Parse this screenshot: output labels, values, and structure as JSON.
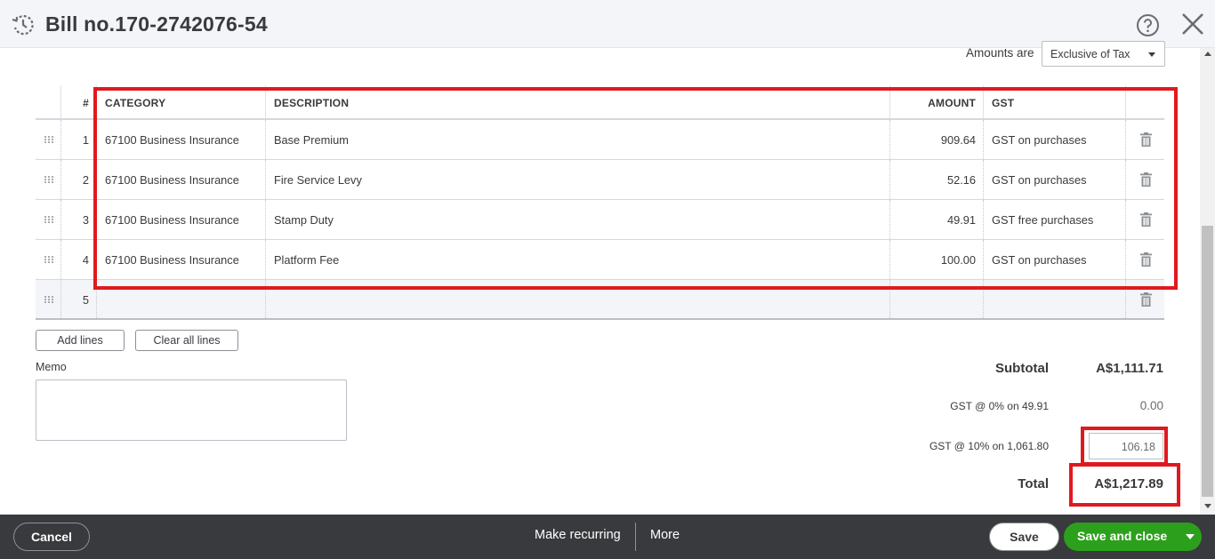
{
  "header": {
    "title": "Bill no.170-2742076-54",
    "history_icon": "history-clock-icon",
    "help_icon": "help-circle-icon",
    "close_icon": "close-x-icon"
  },
  "amounts": {
    "label": "Amounts are",
    "selected": "Exclusive of Tax"
  },
  "table": {
    "headers": {
      "num": "#",
      "category": "CATEGORY",
      "description": "DESCRIPTION",
      "amount": "AMOUNT",
      "gst": "GST"
    },
    "rows": [
      {
        "num": "1",
        "category": "67100 Business Insurance",
        "description": "Base Premium",
        "amount": "909.64",
        "gst": "GST on purchases"
      },
      {
        "num": "2",
        "category": "67100 Business Insurance",
        "description": "Fire Service Levy",
        "amount": "52.16",
        "gst": "GST on purchases"
      },
      {
        "num": "3",
        "category": "67100 Business Insurance",
        "description": "Stamp Duty",
        "amount": "49.91",
        "gst": "GST free purchases"
      },
      {
        "num": "4",
        "category": "67100 Business Insurance",
        "description": "Platform Fee",
        "amount": "100.00",
        "gst": "GST on purchases"
      },
      {
        "num": "5",
        "category": "",
        "description": "",
        "amount": "",
        "gst": ""
      }
    ]
  },
  "actions": {
    "add_lines": "Add lines",
    "clear_all_lines": "Clear all lines"
  },
  "memo": {
    "label": "Memo",
    "value": ""
  },
  "totals": {
    "subtotal_label": "Subtotal",
    "subtotal_value": "A$1,111.71",
    "gst0_label": "GST @ 0% on 49.91",
    "gst0_value": "0.00",
    "gst10_label": "GST @ 10% on 1,061.80",
    "gst10_value": "106.18",
    "total_label": "Total",
    "total_value": "A$1,217.89"
  },
  "footer": {
    "cancel": "Cancel",
    "make_recurring": "Make recurring",
    "more": "More",
    "save": "Save",
    "save_and_close": "Save and close"
  },
  "colors": {
    "highlight": "#e0191f",
    "primary_green": "#2ca01c",
    "footer_bg": "#393a3d",
    "header_bg": "#f4f5f8"
  }
}
